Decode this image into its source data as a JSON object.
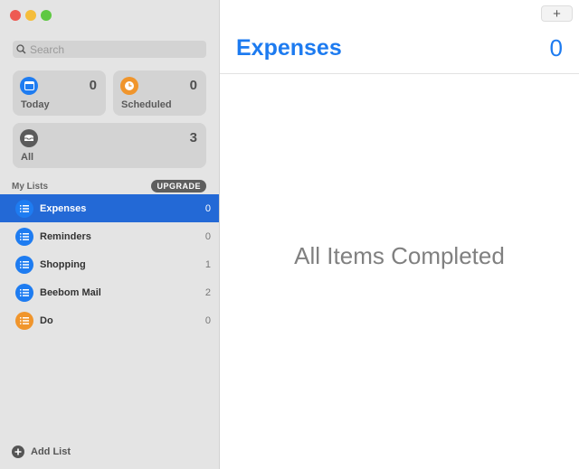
{
  "window": {
    "controls": [
      "close",
      "minimize",
      "maximize"
    ]
  },
  "sidebar": {
    "search": {
      "placeholder": "Search",
      "value": ""
    },
    "smart_lists": [
      {
        "label": "Today",
        "count": "0",
        "icon": "calendar-icon",
        "color": "#1e7cf1"
      },
      {
        "label": "Scheduled",
        "count": "0",
        "icon": "clock-icon",
        "color": "#f0952c"
      },
      {
        "label": "All",
        "count": "3",
        "icon": "tray-icon",
        "color": "#5b5b5b"
      }
    ],
    "my_lists_label": "My Lists",
    "upgrade_label": "UPGRADE",
    "lists": [
      {
        "name": "Expenses",
        "count": "0",
        "color": "#1e7cf1",
        "selected": true
      },
      {
        "name": "Reminders",
        "count": "0",
        "color": "#1e7cf1",
        "selected": false
      },
      {
        "name": "Shopping",
        "count": "1",
        "color": "#1e7cf1",
        "selected": false
      },
      {
        "name": "Beebom Mail",
        "count": "2",
        "color": "#1e7cf1",
        "selected": false
      },
      {
        "name": "Do",
        "count": "0",
        "color": "#f0952c",
        "selected": false
      }
    ],
    "add_list_label": "Add List"
  },
  "main": {
    "add_button": "+",
    "title": "Expenses",
    "count": "0",
    "empty_message": "All Items Completed",
    "accent": "#1d7bf0"
  }
}
